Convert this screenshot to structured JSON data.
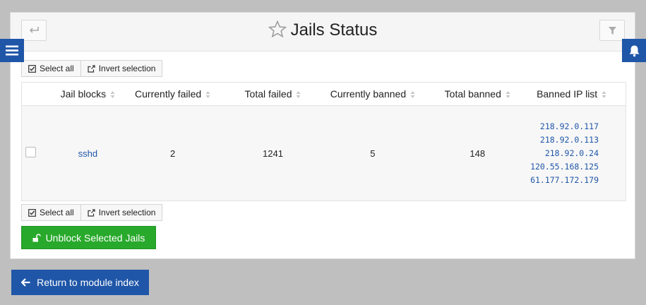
{
  "header": {
    "title": "Jails Status"
  },
  "selection_bar": {
    "select_all_label": "Select all",
    "invert_selection_label": "Invert selection"
  },
  "table": {
    "columns": [
      "Jail blocks",
      "Currently failed",
      "Total failed",
      "Currently banned",
      "Total banned",
      "Banned IP list"
    ],
    "rows": [
      {
        "jail": "sshd",
        "currently_failed": "2",
        "total_failed": "1241",
        "currently_banned": "5",
        "total_banned": "148",
        "banned_ips": [
          "218.92.0.117",
          "218.92.0.113",
          "218.92.0.24",
          "120.55.168.125",
          "61.177.172.179"
        ]
      }
    ]
  },
  "actions": {
    "unblock_label": "Unblock Selected Jails",
    "return_label": "Return to module index"
  },
  "colors": {
    "primary": "#1f56a8",
    "success": "#28a92b"
  }
}
